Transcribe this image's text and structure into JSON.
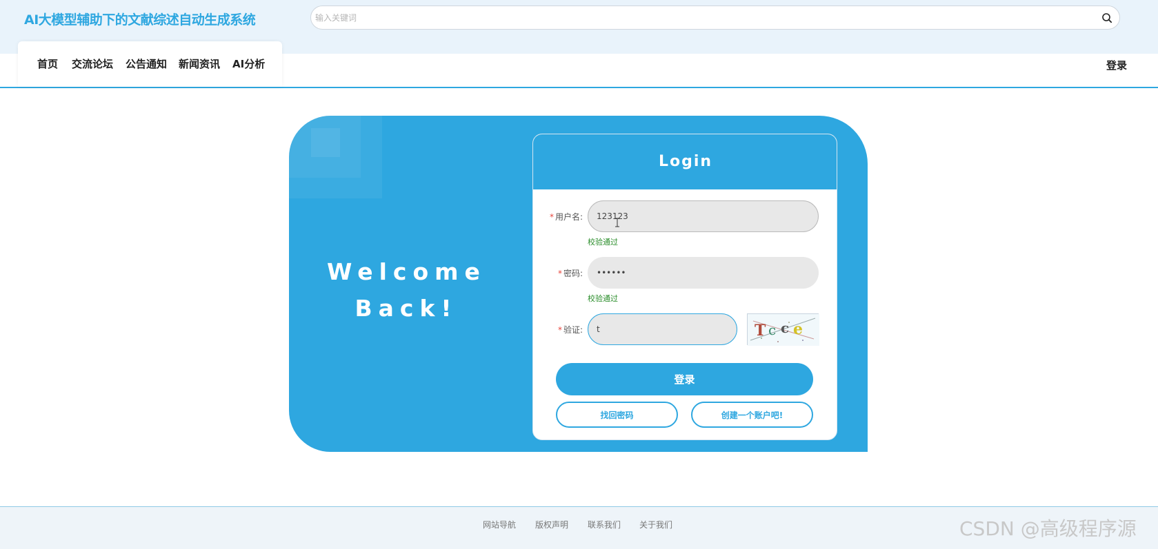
{
  "header": {
    "site_title": "AI大模型辅助下的文献综述自动生成系统",
    "search_placeholder": "输入关键词"
  },
  "nav": {
    "items": [
      {
        "label": "首页"
      },
      {
        "label": "交流论坛"
      },
      {
        "label": "公告通知"
      },
      {
        "label": "新闻资讯"
      },
      {
        "label": "AI分析"
      }
    ],
    "login_label": "登录"
  },
  "login_panel": {
    "welcome_line1": "Welcome",
    "welcome_line2": "Back!",
    "title": "Login",
    "username_label": "用户名:",
    "username_value": "123123",
    "username_status": "校验通过",
    "password_label": "密码:",
    "password_value": "••••••",
    "password_status": "校验通过",
    "captcha_label": "验证:",
    "captcha_value": "t",
    "captcha_text": "Tcce",
    "login_button": "登录",
    "forgot_button": "找回密码",
    "register_button": "创建一个账户吧!"
  },
  "footer": {
    "links": [
      "网站导航",
      "版权声明",
      "联系我们",
      "关于我们"
    ],
    "watermark": "CSDN @高级程序源"
  },
  "colors": {
    "accent": "#2ea7e0",
    "valid_text": "#2a8d2a",
    "required_star": "#e8453c"
  }
}
